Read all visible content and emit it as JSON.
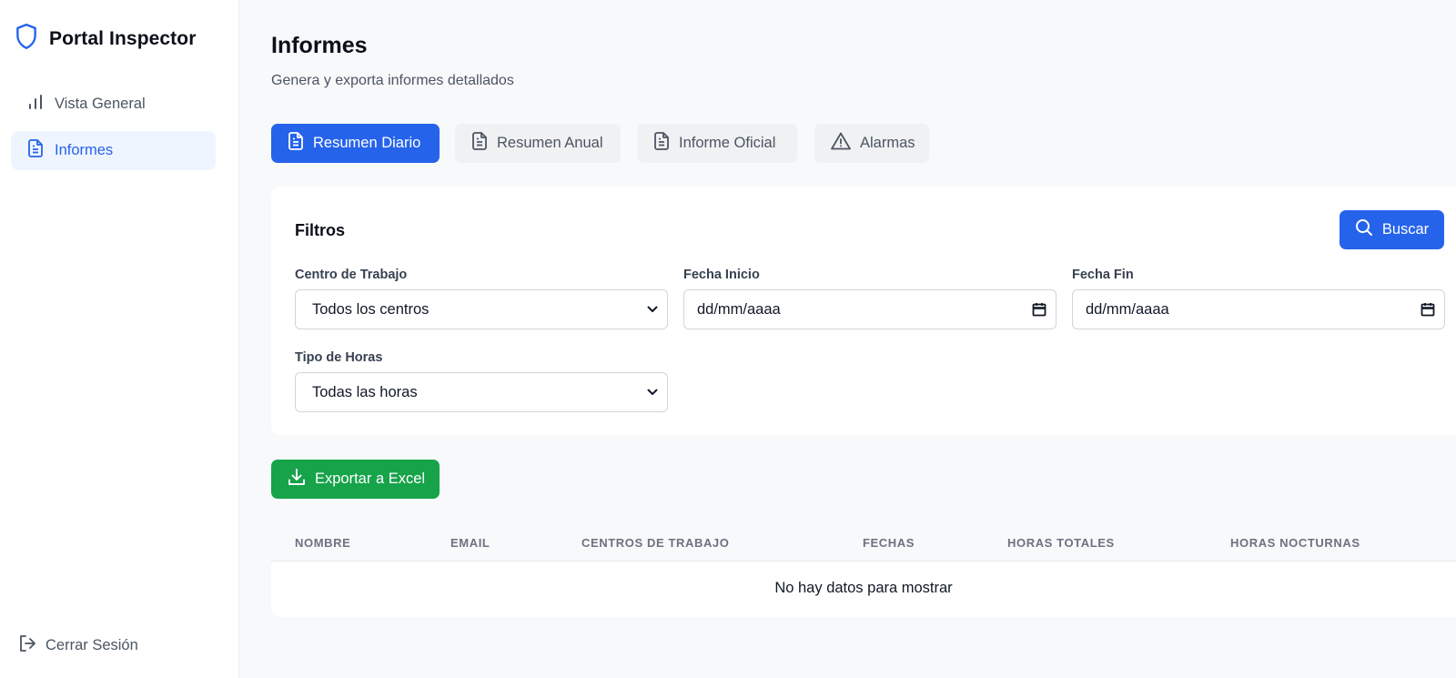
{
  "app": {
    "title": "Portal Inspector"
  },
  "sidebar": {
    "items": [
      {
        "label": "Vista General",
        "icon": "bar-chart-icon",
        "active": false
      },
      {
        "label": "Informes",
        "icon": "document-icon",
        "active": true
      }
    ],
    "logout_label": "Cerrar Sesión"
  },
  "page": {
    "title": "Informes",
    "subtitle": "Genera y exporta informes detallados"
  },
  "tabs": [
    {
      "label": "Resumen Diario",
      "icon": "document-icon",
      "active": true
    },
    {
      "label": "Resumen Anual",
      "icon": "document-icon",
      "active": false
    },
    {
      "label": "Informe Oficial",
      "icon": "document-icon",
      "active": false
    },
    {
      "label": "Alarmas",
      "icon": "warning-icon",
      "active": false
    }
  ],
  "filters": {
    "title": "Filtros",
    "search_label": "Buscar",
    "centro": {
      "label": "Centro de Trabajo",
      "value": "Todos los centros"
    },
    "fecha_inicio": {
      "label": "Fecha Inicio",
      "value": "dd/mm/aaaa"
    },
    "fecha_fin": {
      "label": "Fecha Fin",
      "value": "dd/mm/aaaa"
    },
    "tipo_horas": {
      "label": "Tipo de Horas",
      "value": "Todas las horas"
    }
  },
  "export": {
    "label": "Exportar a Excel"
  },
  "table": {
    "columns": [
      "NOMBRE",
      "EMAIL",
      "CENTROS DE TRABAJO",
      "FECHAS",
      "HORAS TOTALES",
      "HORAS NOCTURNAS"
    ],
    "empty_message": "No hay datos para mostrar"
  },
  "colors": {
    "primary": "#2563eb",
    "success": "#16a34a",
    "active_nav_bg": "#eff5ff"
  }
}
